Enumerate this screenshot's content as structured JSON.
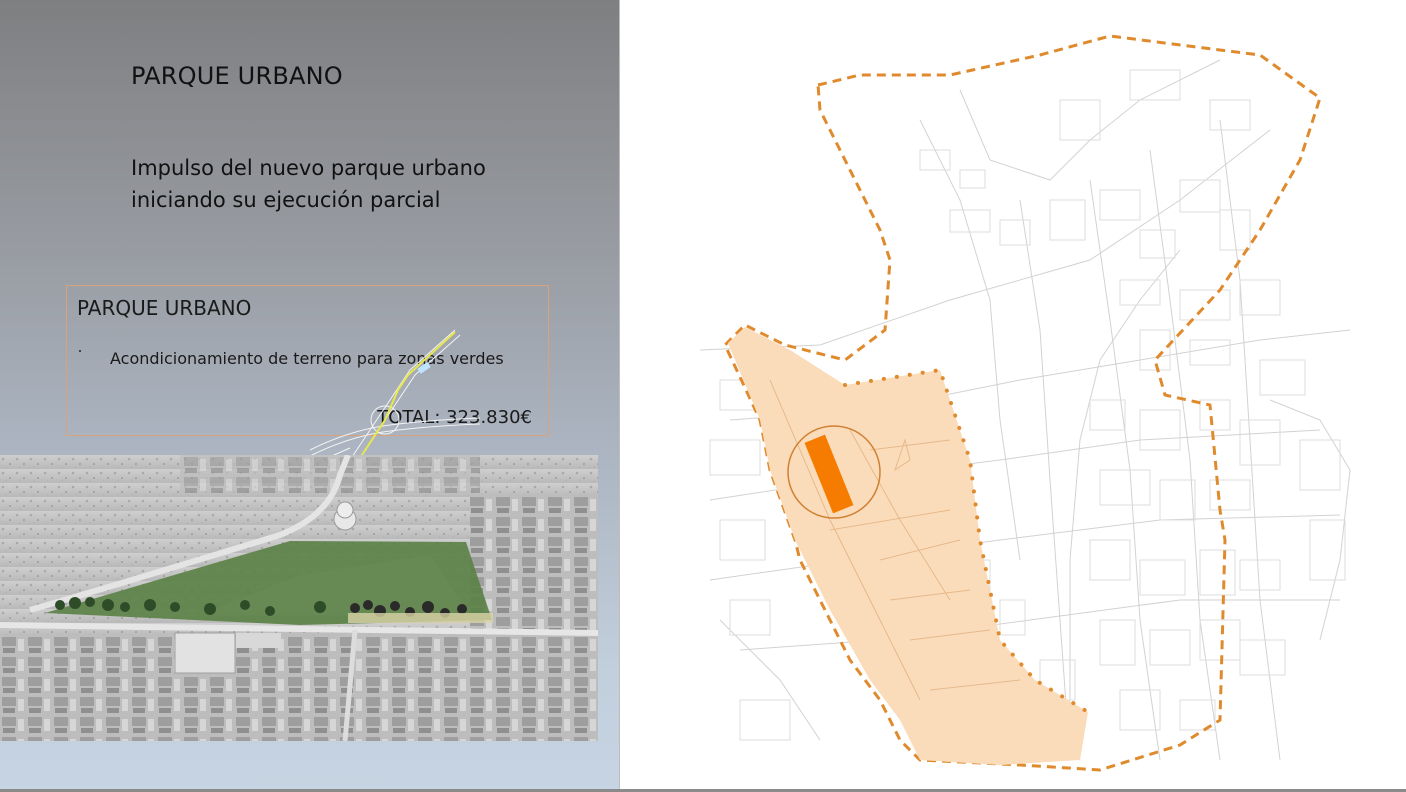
{
  "slide": {
    "title": "PARQUE URBANO",
    "subtitle": "Impulso del nuevo parque urbano iniciando su ejecución parcial"
  },
  "info_box": {
    "title": "PARQUE URBANO",
    "bullet": "Acondicionamiento de terreno para zonas verdes",
    "total": "TOTAL: 323.830€"
  },
  "colors": {
    "boundary": "#e08a2e",
    "highlight_fill": "#fbdcba",
    "marker": "#f57c00",
    "park_green": "#4f7a3f",
    "box_border": "#d9a27c"
  }
}
